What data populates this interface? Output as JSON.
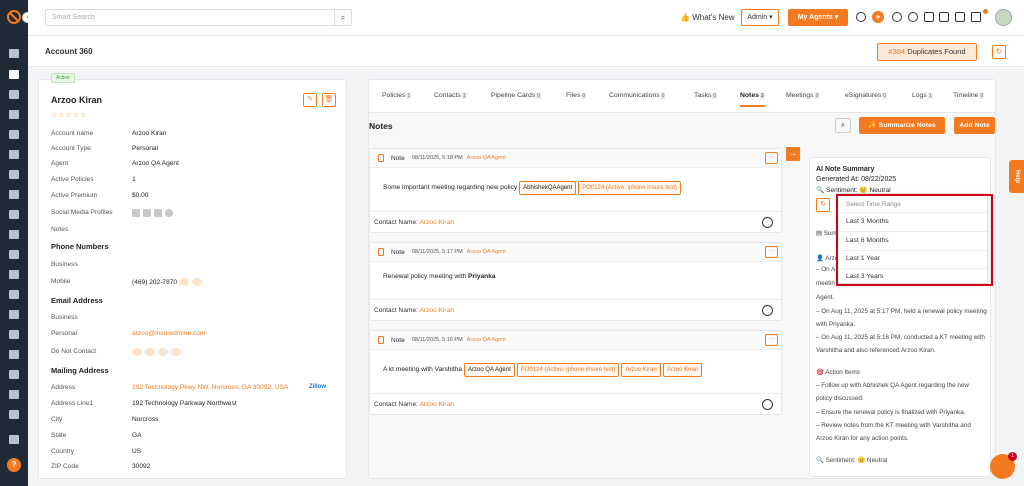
{
  "topbar": {
    "search_placeholder": "Smart Search",
    "whats_new": "What's New",
    "admin": "Admin",
    "my_agents": "My Agents"
  },
  "header": {
    "title": "Account 360",
    "duplicates_count": "#384",
    "duplicates_label": "Duplicates Found"
  },
  "account": {
    "status": "Active",
    "name": "Arzoo Kiran",
    "stars": "☆☆☆☆☆",
    "fields": [
      {
        "label": "Account name",
        "value": "Arzoo Kiran"
      },
      {
        "label": "Account Type",
        "value": "Personal"
      },
      {
        "label": "Agent",
        "value": "Arzoo QA Agent"
      },
      {
        "label": "Active Policies",
        "value": "1"
      },
      {
        "label": "Active Premium",
        "value": "$0.00"
      },
      {
        "label": "Social Media Profiles",
        "value": ""
      },
      {
        "label": "Notes",
        "value": ""
      }
    ],
    "phone_title": "Phone Numbers",
    "phones": [
      {
        "label": "Business",
        "value": ""
      },
      {
        "label": "Mobile",
        "value": "(469) 202-7870"
      }
    ],
    "email_title": "Email Address",
    "emails": [
      {
        "label": "Business",
        "value": ""
      },
      {
        "label": "Personal",
        "value": "arzoo@insuredmine.com"
      },
      {
        "label": "Do Not Contact",
        "value": ""
      }
    ],
    "mailing_title": "Mailing Address",
    "mailing": [
      {
        "label": "Address",
        "value": "192 Technology Pkwy NW, Norcross, GA 30092, USA"
      },
      {
        "label": "Address Line1",
        "value": "192 Technology Parkway Northwest"
      },
      {
        "label": "City",
        "value": "Norcross"
      },
      {
        "label": "State",
        "value": "GA"
      },
      {
        "label": "Country",
        "value": "US"
      },
      {
        "label": "ZIP Code",
        "value": "30092"
      }
    ],
    "zillow": "Zillow"
  },
  "tabs": [
    {
      "label": "Policies",
      "count": "1"
    },
    {
      "label": "Contacts",
      "count": "1"
    },
    {
      "label": "Pipeline Cards",
      "count": "0"
    },
    {
      "label": "Files",
      "count": "0"
    },
    {
      "label": "Communications",
      "count": "0"
    },
    {
      "label": "Tasks",
      "count": "0"
    },
    {
      "label": "Notes",
      "count": "3"
    },
    {
      "label": "Meetings",
      "count": "0"
    },
    {
      "label": "eSignatures",
      "count": "0"
    },
    {
      "label": "Logs",
      "count": "1"
    },
    {
      "label": "Timeline",
      "count": "0"
    }
  ],
  "notes_panel": {
    "title": "Notes",
    "summarize": "Summarize Notes",
    "add": "Add Note",
    "notes": [
      {
        "label": "Note",
        "date": "08/11/2025, 5:18 PM",
        "agent": "Arzoo QA Agent",
        "text": "Some important meeting regarding new policy",
        "tags": [
          "AbhishekQAAgent",
          "PO0124 (Active, iphone insure test)"
        ],
        "contact_label": "Contact Name:",
        "contact": "Arzoo Kiran"
      },
      {
        "label": "Note",
        "date": "08/11/2025, 5:17 PM",
        "agent": "Arzoo QA Agent",
        "text": "Renewal policy meeting with ",
        "bold": "Priyanka",
        "tags": [],
        "contact_label": "Contact Name:",
        "contact": "Arzoo Kiran"
      },
      {
        "label": "Note",
        "date": "08/11/2025, 5:16 PM",
        "agent": "Arzoo QA Agent",
        "text": "A kt meeting with Varshitha",
        "tags": [
          "Arzoo QA Agent",
          "PO0124 (Active, iphone insure test)",
          "Arzoo Kiran",
          "Arzoo Kiran"
        ],
        "contact_label": "Contact Name:",
        "contact": "Arzoo Kiran"
      }
    ]
  },
  "ai_summary": {
    "title": "AI Note Summary",
    "generated": "Generated At: 08/22/2025",
    "sentiment": "Sentiment: 😐 Neutral",
    "summary_label": "Sum",
    "agent_prefix": "👤 Arzo",
    "lines": [
      "– On A",
      "meetin",
      "Agent.",
      "– On Aug 11, 2025 at 5:17 PM, held a renewal policy meeting",
      "with Priyanka.",
      "– On Aug 11, 2025 at 5:16 PM, conducted a KT meeting with",
      "Varshitha and also referenced Arzoo Kiran.",
      "",
      "🎯 Action Items",
      "– Follow up with Abhishek QA Agent regarding the new",
      "policy discussed.",
      "– Ensure the renewal policy is finalized with Priyanka.",
      "– Review notes from the KT meeting with Varshitha and",
      "Arzoo Kiran for any action points.",
      "",
      "🔍 Sentiment: 😐 Neutral"
    ]
  },
  "time_range": {
    "placeholder": "Select Time Range",
    "options": [
      "Last 3 Months",
      "Last 6 Months",
      "Last 1 Year",
      "Last 3 Years"
    ]
  },
  "help_tab": "Help",
  "chat_count": "1",
  "colors": {
    "accent": "#f47a20",
    "sidebar": "#1f2a36",
    "highlight": "#d0021b"
  }
}
